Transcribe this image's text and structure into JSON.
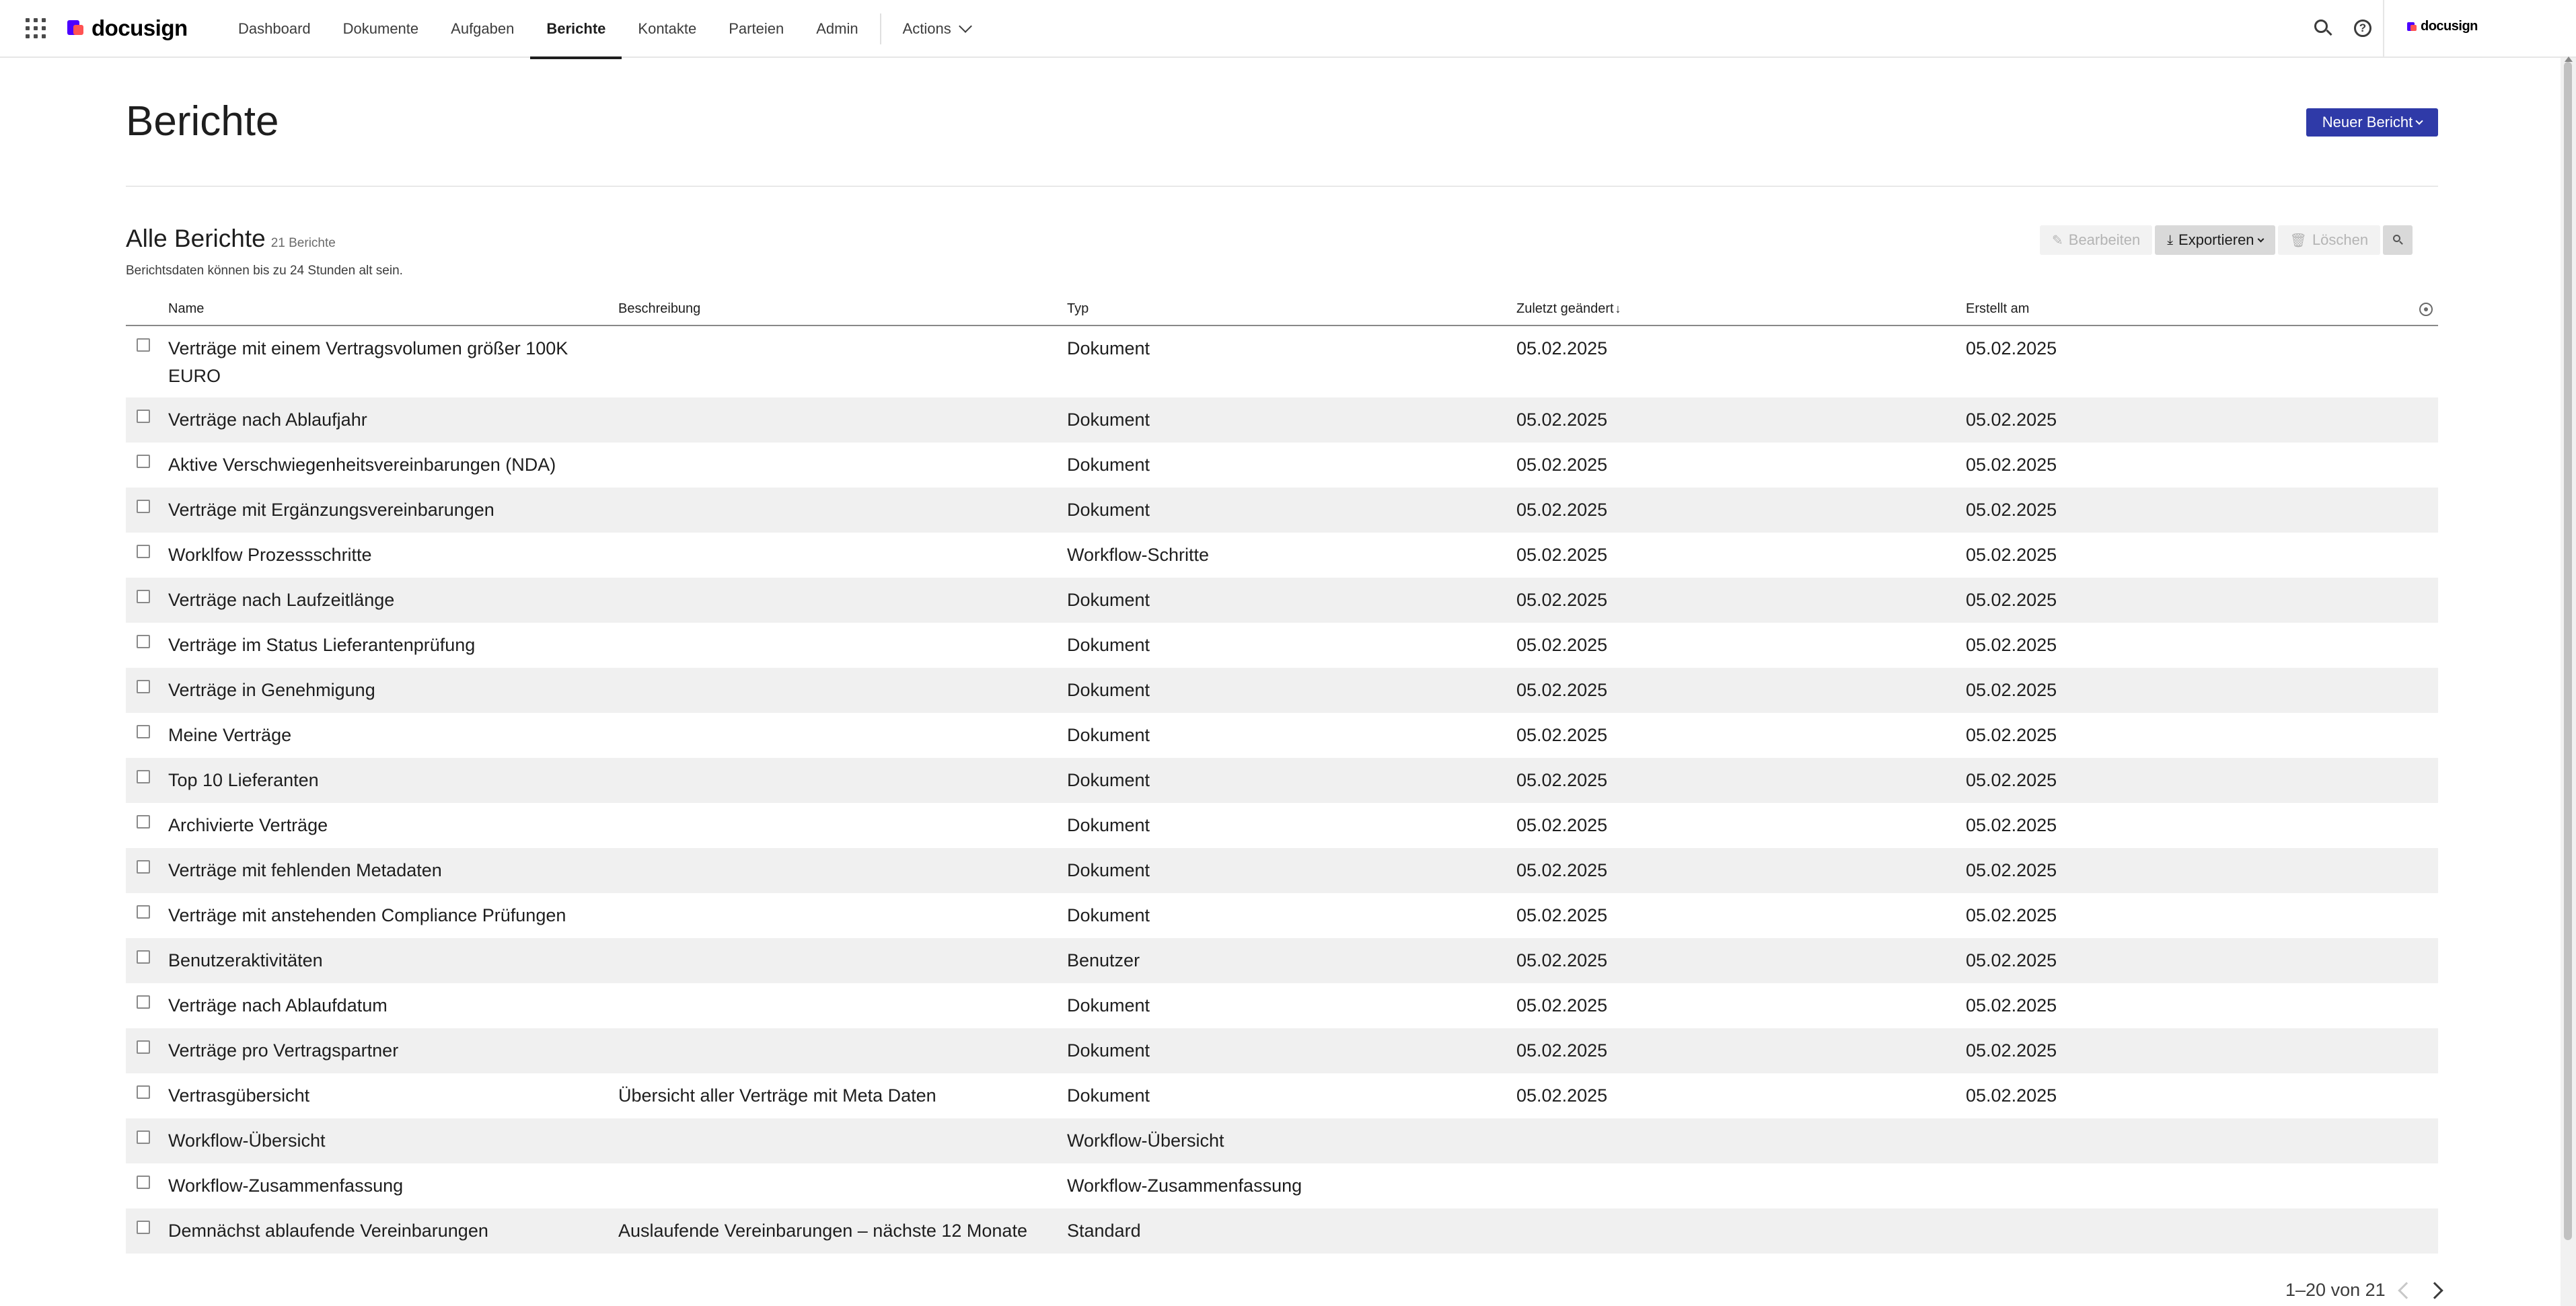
{
  "app": {
    "logo_text": "docusign",
    "account_label": "docusign"
  },
  "nav": {
    "items": [
      {
        "label": "Dashboard"
      },
      {
        "label": "Dokumente"
      },
      {
        "label": "Aufgaben"
      },
      {
        "label": "Berichte",
        "active": true
      },
      {
        "label": "Kontakte"
      },
      {
        "label": "Parteien"
      },
      {
        "label": "Admin"
      }
    ],
    "actions_label": "Actions"
  },
  "header": {
    "title": "Berichte",
    "new_report_label": "Neuer Bericht"
  },
  "section": {
    "title": "Alle Berichte",
    "count_label": "21 Berichte",
    "note": "Berichtsdaten können bis zu 24 Stunden alt sein."
  },
  "toolbar": {
    "edit_label": "Bearbeiten",
    "export_label": "Exportieren",
    "delete_label": "Löschen"
  },
  "table": {
    "columns": {
      "name": "Name",
      "description": "Beschreibung",
      "type": "Typ",
      "modified": "Zuletzt geändert",
      "created": "Erstellt am"
    },
    "rows": [
      {
        "name": "Verträge mit einem Vertragsvolumen größer 100K EURO",
        "description": "",
        "type": "Dokument",
        "modified": "05.02.2025",
        "created": "05.02.2025"
      },
      {
        "name": "Verträge nach Ablaufjahr",
        "description": "",
        "type": "Dokument",
        "modified": "05.02.2025",
        "created": "05.02.2025"
      },
      {
        "name": "Aktive Verschwiegenheitsvereinbarungen (NDA)",
        "description": "",
        "type": "Dokument",
        "modified": "05.02.2025",
        "created": "05.02.2025"
      },
      {
        "name": "Verträge mit Ergänzungsvereinbarungen",
        "description": "",
        "type": "Dokument",
        "modified": "05.02.2025",
        "created": "05.02.2025"
      },
      {
        "name": "Worklfow Prozessschritte",
        "description": "",
        "type": "Workflow-Schritte",
        "modified": "05.02.2025",
        "created": "05.02.2025"
      },
      {
        "name": "Verträge nach Laufzeitlänge",
        "description": "",
        "type": "Dokument",
        "modified": "05.02.2025",
        "created": "05.02.2025"
      },
      {
        "name": "Verträge im Status Lieferantenprüfung",
        "description": "",
        "type": "Dokument",
        "modified": "05.02.2025",
        "created": "05.02.2025"
      },
      {
        "name": "Verträge in Genehmigung",
        "description": "",
        "type": "Dokument",
        "modified": "05.02.2025",
        "created": "05.02.2025"
      },
      {
        "name": "Meine Verträge",
        "description": "",
        "type": "Dokument",
        "modified": "05.02.2025",
        "created": "05.02.2025"
      },
      {
        "name": "Top 10 Lieferanten",
        "description": "",
        "type": "Dokument",
        "modified": "05.02.2025",
        "created": "05.02.2025"
      },
      {
        "name": "Archivierte Verträge",
        "description": "",
        "type": "Dokument",
        "modified": "05.02.2025",
        "created": "05.02.2025"
      },
      {
        "name": "Verträge mit fehlenden Metadaten",
        "description": "",
        "type": "Dokument",
        "modified": "05.02.2025",
        "created": "05.02.2025"
      },
      {
        "name": "Verträge mit anstehenden Compliance Prüfungen",
        "description": "",
        "type": "Dokument",
        "modified": "05.02.2025",
        "created": "05.02.2025"
      },
      {
        "name": "Benutzeraktivitäten",
        "description": "",
        "type": "Benutzer",
        "modified": "05.02.2025",
        "created": "05.02.2025"
      },
      {
        "name": "Verträge nach Ablaufdatum",
        "description": "",
        "type": "Dokument",
        "modified": "05.02.2025",
        "created": "05.02.2025"
      },
      {
        "name": "Verträge pro Vertragspartner",
        "description": "",
        "type": "Dokument",
        "modified": "05.02.2025",
        "created": "05.02.2025"
      },
      {
        "name": "Vertrasgübersicht",
        "description": "Übersicht aller Verträge mit Meta Daten",
        "type": "Dokument",
        "modified": "05.02.2025",
        "created": "05.02.2025"
      },
      {
        "name": "Workflow-Übersicht",
        "description": "",
        "type": "Workflow-Übersicht",
        "modified": "",
        "created": ""
      },
      {
        "name": "Workflow-Zusammenfassung",
        "description": "",
        "type": "Workflow-Zusammenfassung",
        "modified": "",
        "created": ""
      },
      {
        "name": "Demnächst ablaufende Vereinbarungen",
        "description": "Auslaufende Vereinbarungen – nächste 12 Monate",
        "type": "Standard",
        "modified": "",
        "created": ""
      }
    ]
  },
  "pagination": {
    "label": "1–20 von 21"
  },
  "colors": {
    "primary": "#2f3aa8",
    "row_alt": "#f0f0f0",
    "logo_purple": "#4c00ff",
    "logo_coral": "#ff5252"
  }
}
